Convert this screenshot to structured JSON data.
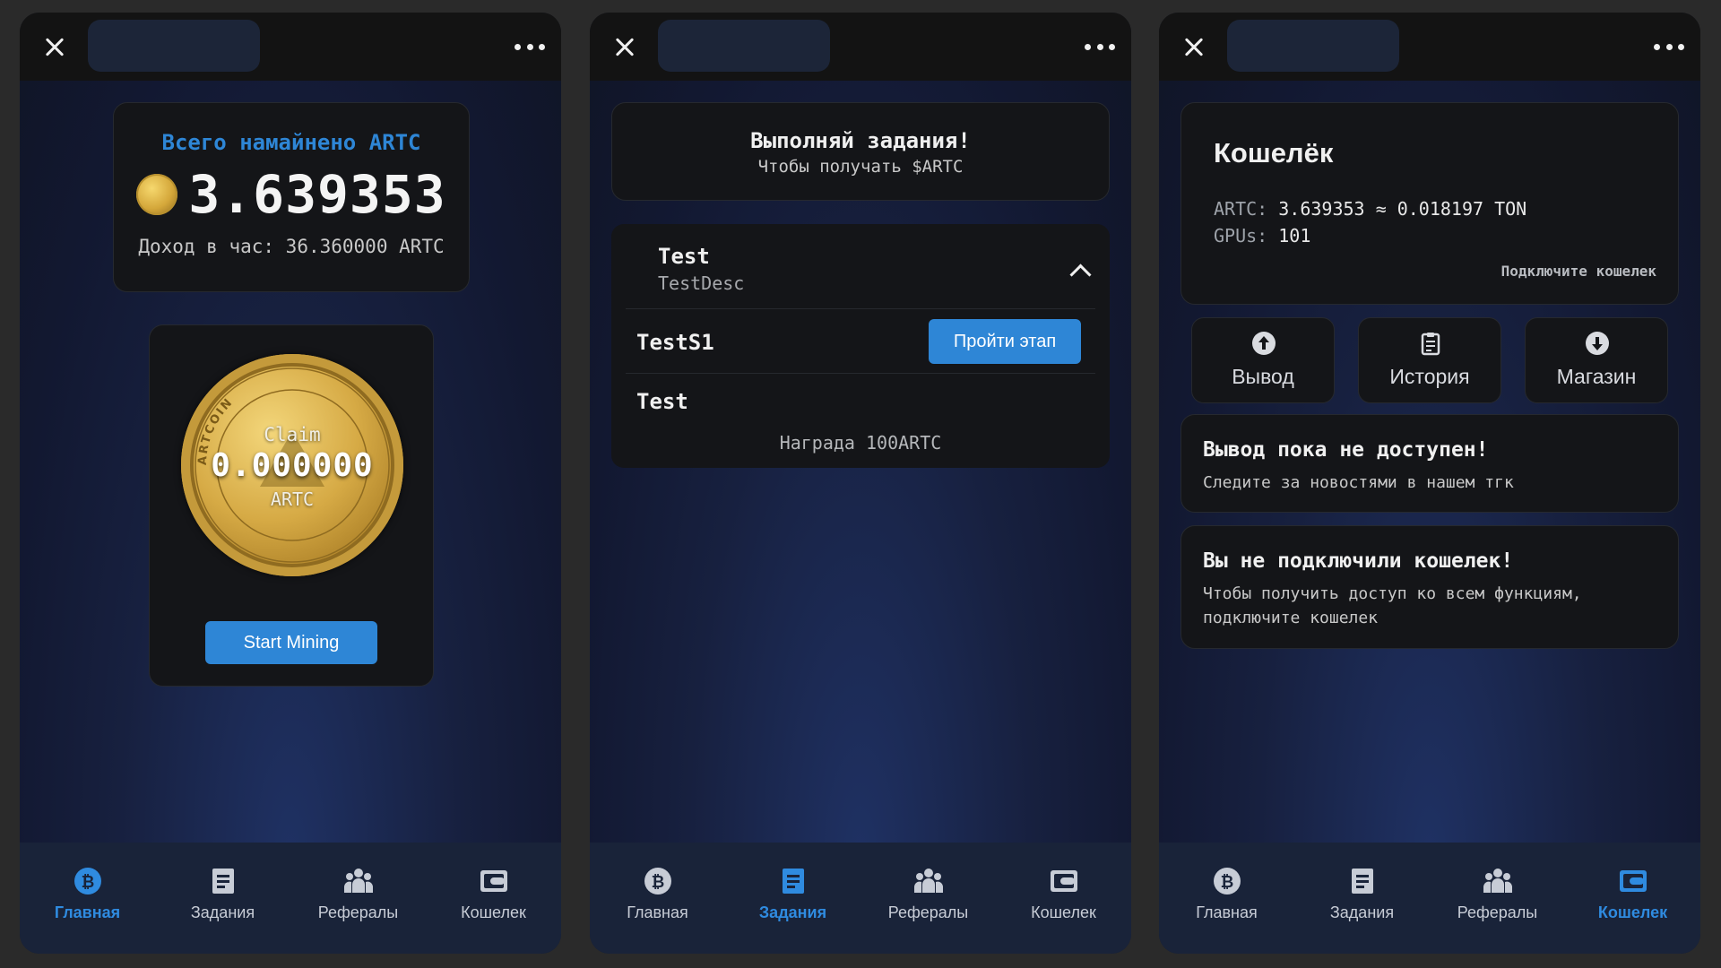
{
  "colors": {
    "accent": "#2e86d6",
    "active_nav": "#2f8be0",
    "mined_title": "#2e86d6"
  },
  "nav": {
    "home": "Главная",
    "tasks": "Задания",
    "referrals": "Рефералы",
    "wallet": "Кошелек"
  },
  "home": {
    "mined_title": "Всего намайнено ARTC",
    "mined_amount": "3.639353",
    "income": "Доход в час: 36.360000 ARTC",
    "claim_label": "Claim",
    "claim_value": "0.000000",
    "claim_unit": "ARTC",
    "coin_ring_text": "ARTCOIN",
    "start_button": "Start Mining"
  },
  "tasks": {
    "header_title": "Выполняй задания!",
    "header_sub": "Чтобы получать $ARTC",
    "task": {
      "name": "Test",
      "desc": "TestDesc",
      "stages": [
        {
          "name": "TestS1",
          "button": "Пройти этап"
        },
        {
          "name": "Test",
          "reward": "Награда 100ARTC"
        }
      ]
    }
  },
  "wallet": {
    "title": "Кошелёк",
    "artc_label": "ARTC:",
    "artc_value": "3.639353 ≈ 0.018197 TON",
    "gpus_label": "GPUs:",
    "gpus_value": "101",
    "connect_link": "Подключите кошелек",
    "actions": [
      {
        "label": "Вывод",
        "icon": "arrow-up-circle-icon"
      },
      {
        "label": "История",
        "icon": "clipboard-icon"
      },
      {
        "label": "Магазин",
        "icon": "arrow-down-circle-icon"
      }
    ],
    "notice1_title": "Вывод пока не доступен!",
    "notice1_text": "Следите за новостями в нашем тгк",
    "notice2_title": "Вы не подключили кошелек!",
    "notice2_text": "Чтобы получить доступ ко всем функциям, подключите кошелек"
  }
}
